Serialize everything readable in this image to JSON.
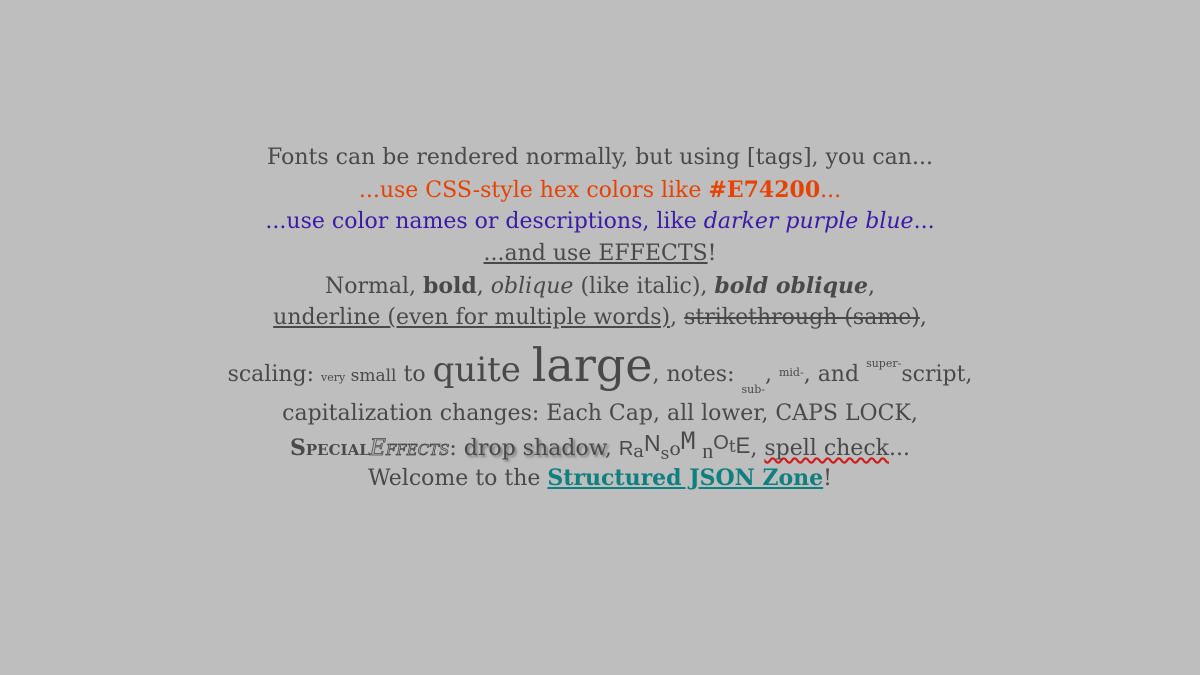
{
  "line1": {
    "text": "Fonts can be rendered normally, but using [tags], you can..."
  },
  "line2": {
    "prefix": "...use CSS-style hex colors like ",
    "hex": "#E74200",
    "suffix": "..."
  },
  "line3": {
    "prefix": "...use color names or descriptions, like ",
    "name": "darker purple blue",
    "suffix": "..."
  },
  "line4": {
    "text": "...and use EFFECTS",
    "suffix": "!"
  },
  "line5": {
    "normal": "Normal, ",
    "bold": "bold",
    "sep1": ", ",
    "oblique": "oblique",
    "mid": " (like italic), ",
    "bold_oblique": "bold oblique",
    "end": ","
  },
  "line6": {
    "underline": "underline (even for multiple words)",
    "sep": ", ",
    "strike": "strikethrough (same)",
    "end": ","
  },
  "line7": {
    "prefix": "scaling: ",
    "very": "very",
    "small": " small",
    "to": " to ",
    "quite": "quite",
    "space": " ",
    "large": "large",
    "notes": ", notes: ",
    "sub": "sub-",
    "comma1": ", ",
    "mid": "mid-",
    "and": ", and ",
    "super": "super-",
    "script": "script,"
  },
  "line8": {
    "text": "capitalization changes: Each Cap, all lower, CAPS LOCK,"
  },
  "line9": {
    "special": "Special",
    "effects": "Effects",
    "colon": ": ",
    "shadow": "drop shadow",
    "sep": ", ",
    "ransom": [
      "R",
      "a",
      "N",
      "s",
      "o",
      "M",
      "n",
      "O",
      "t",
      "E"
    ],
    "sep2": ", ",
    "spell": "spell check",
    "end": "..."
  },
  "line10": {
    "prefix": "Welcome to the ",
    "link": "Structured JSON Zone",
    "suffix": "!"
  },
  "colors": {
    "background": "#bebebe",
    "text": "#494949",
    "hex_accent": "#E74200",
    "purple_blue": "#3a1aa8",
    "link_teal": "#0f8080"
  }
}
